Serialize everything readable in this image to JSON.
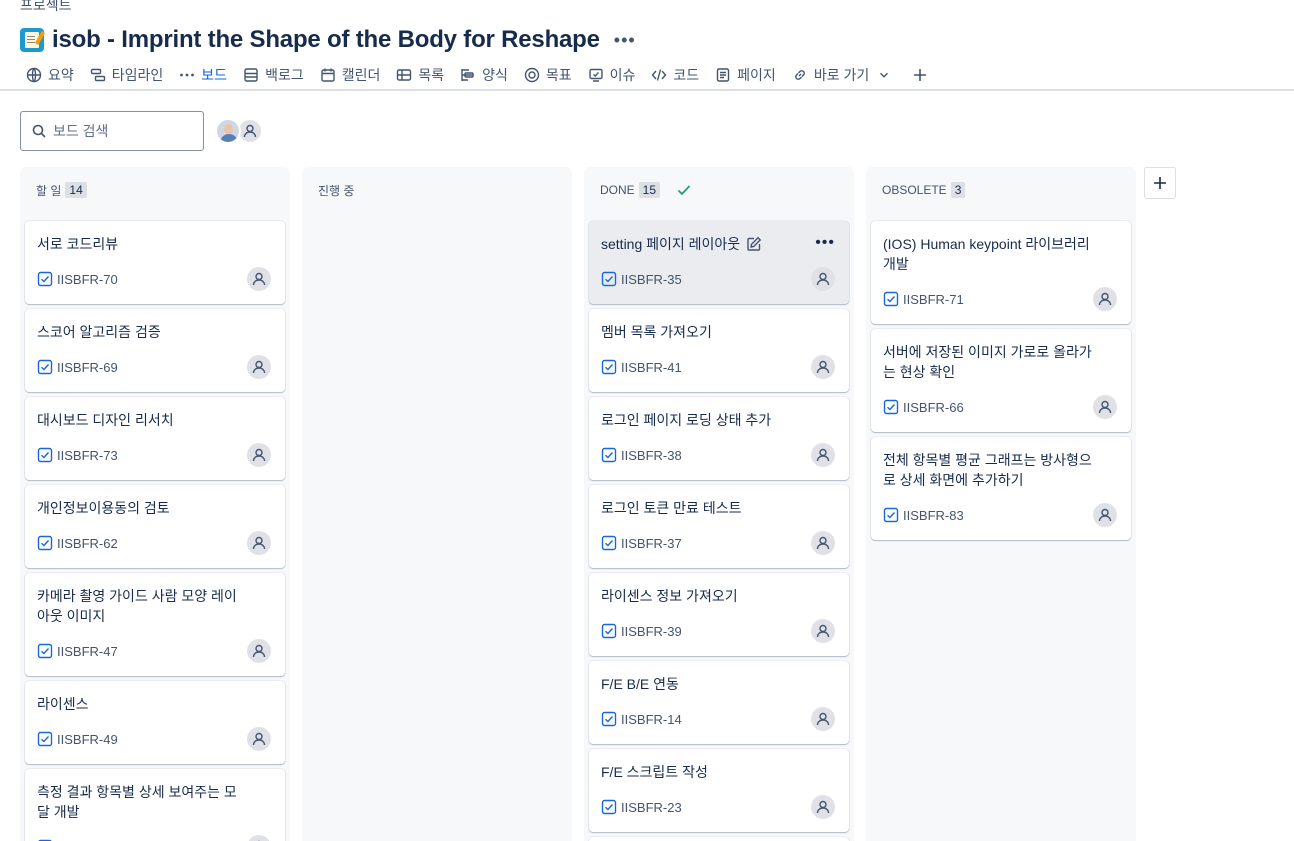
{
  "breadcrumb": "프로젝트",
  "project": {
    "title": "isob - Imprint the Shape of the Body for Reshape"
  },
  "tabs": [
    {
      "label": "요약",
      "icon": "globe-icon"
    },
    {
      "label": "타임라인",
      "icon": "timeline-icon"
    },
    {
      "label": "보드",
      "icon": "more-dots-icon",
      "active": true
    },
    {
      "label": "백로그",
      "icon": "backlog-icon"
    },
    {
      "label": "캘린더",
      "icon": "calendar-icon"
    },
    {
      "label": "목록",
      "icon": "list-icon"
    },
    {
      "label": "양식",
      "icon": "form-icon"
    },
    {
      "label": "목표",
      "icon": "goal-icon"
    },
    {
      "label": "이슈",
      "icon": "issues-icon"
    },
    {
      "label": "코드",
      "icon": "code-icon"
    },
    {
      "label": "페이지",
      "icon": "page-icon"
    },
    {
      "label": "바로 가기",
      "icon": "link-icon"
    }
  ],
  "search": {
    "placeholder": "보드 검색"
  },
  "columns": [
    {
      "name": "할 일",
      "count": "14",
      "cards": [
        {
          "title": "서로 코드리뷰",
          "key": "IISBFR-70"
        },
        {
          "title": "스코어 알고리즘 검증",
          "key": "IISBFR-69"
        },
        {
          "title": "대시보드 디자인 리서치",
          "key": "IISBFR-73"
        },
        {
          "title": "개인정보이용동의 검토",
          "key": "IISBFR-62"
        },
        {
          "title": "카메라 촬영 가이드 사람 모양 레이아웃 이미지",
          "key": "IISBFR-47"
        },
        {
          "title": "라이센스",
          "key": "IISBFR-49"
        },
        {
          "title": "측정 결과 항목별 상세 보여주는 모달 개발",
          "key": ""
        }
      ]
    },
    {
      "name": "진행 중",
      "count": "",
      "cards": []
    },
    {
      "name": "DONE",
      "count": "15",
      "cards": [
        {
          "title": "setting 페이지 레이아웃",
          "key": "IISBFR-35"
        },
        {
          "title": "멤버 목록 가져오기",
          "key": "IISBFR-41"
        },
        {
          "title": "로그인 페이지 로딩 상태 추가",
          "key": "IISBFR-38"
        },
        {
          "title": "로그인 토큰 만료 테스트",
          "key": "IISBFR-37"
        },
        {
          "title": "라이센스 정보 가져오기",
          "key": "IISBFR-39"
        },
        {
          "title": "F/E B/E 연동",
          "key": "IISBFR-14"
        },
        {
          "title": "F/E 스크립트 작성",
          "key": "IISBFR-23"
        }
      ]
    },
    {
      "name": "OBSOLETE",
      "count": "3",
      "cards": [
        {
          "title": "(IOS) Human keypoint 라이브러리 개발",
          "key": "IISBFR-71"
        },
        {
          "title": "서버에 저장된 이미지 가로로 올라가는 현상 확인",
          "key": "IISBFR-66"
        },
        {
          "title": "전체 항목별 평균 그래프는 방사형으로 상세 화면에 추가하기",
          "key": "IISBFR-83"
        }
      ]
    }
  ],
  "colors": {
    "accent": "#0c66e4",
    "done_check": "#22a06b",
    "task_icon": "#1868db"
  }
}
